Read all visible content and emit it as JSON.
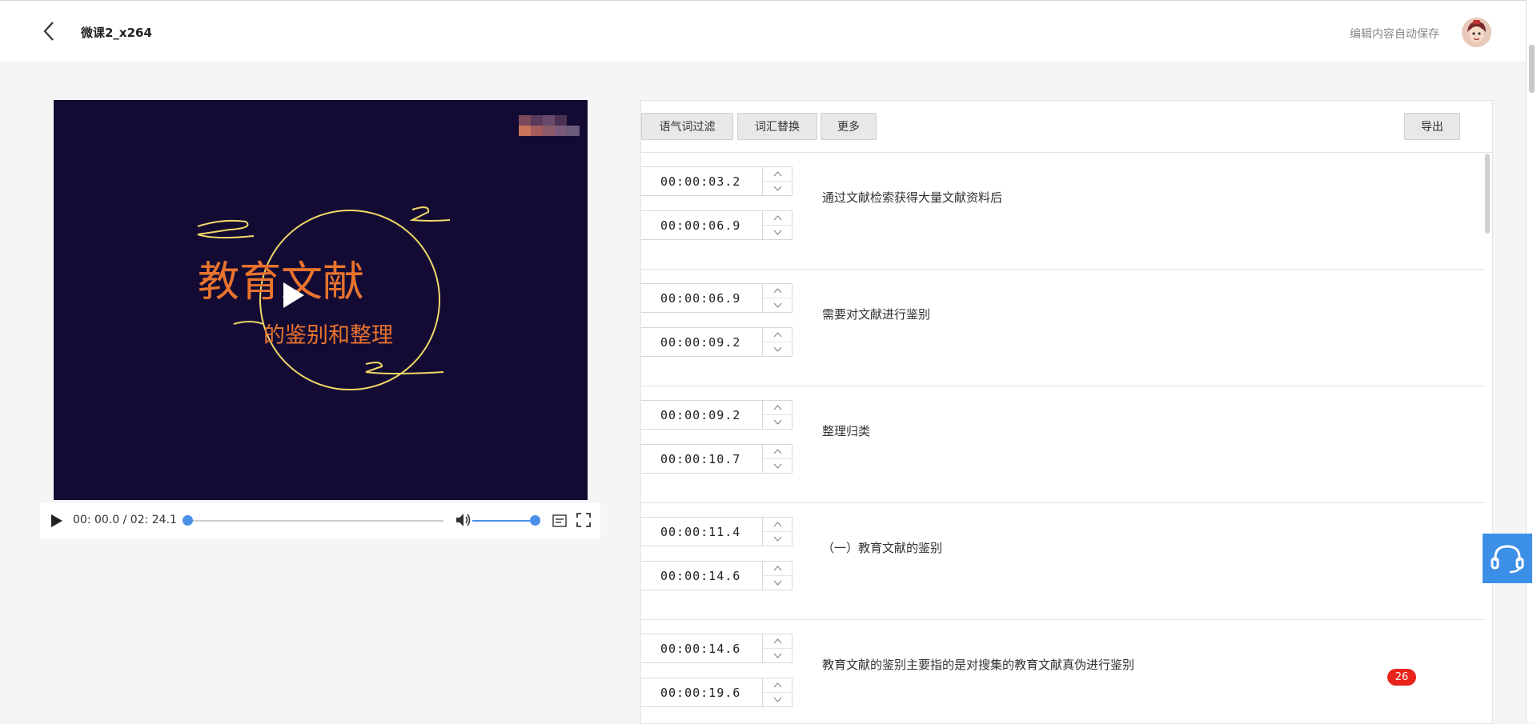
{
  "header": {
    "title": "微课2_x264",
    "autosave_text": "编辑内容自动保存"
  },
  "player": {
    "title_main": "教育文献",
    "title_sub": "的鉴别和整理",
    "current_time": "00: 00.0",
    "separator": "/",
    "duration": "02: 24.1",
    "progress": 0,
    "volume": 1.0
  },
  "toolbar": {
    "filter_label": "语气词过滤",
    "replace_label": "词汇替换",
    "more_label": "更多",
    "export_label": "导出"
  },
  "segments": [
    {
      "start": "00:00:03.2",
      "end": "00:00:06.9",
      "text": "通过文献检索获得大量文献资料后"
    },
    {
      "start": "00:00:06.9",
      "end": "00:00:09.2",
      "text": "需要对文献进行鉴别"
    },
    {
      "start": "00:00:09.2",
      "end": "00:00:10.7",
      "text": "整理归类"
    },
    {
      "start": "00:00:11.4",
      "end": "00:00:14.6",
      "text": "（一）教育文献的鉴别"
    },
    {
      "start": "00:00:14.6",
      "end": "00:00:19.6",
      "text": "教育文献的鉴别主要指的是对搜集的教育文献真伪进行鉴别"
    }
  ],
  "badge_count": "26",
  "colors": {
    "accent": "#4a8fe8",
    "video_bg": "#140b34",
    "title_orange": "#e8742e",
    "badge_red": "#e8241c",
    "support_blue": "#3c8fe6"
  }
}
